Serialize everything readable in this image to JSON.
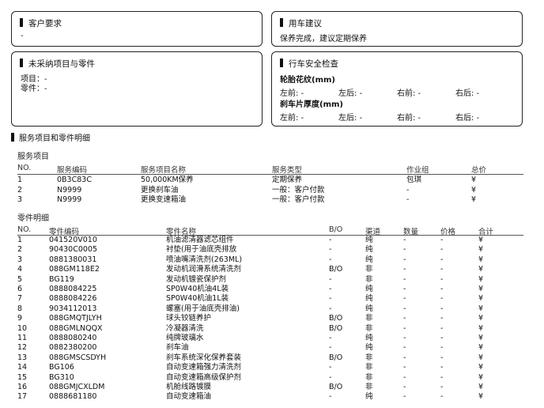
{
  "customer_request": {
    "title": "客户要求",
    "value": "-"
  },
  "suggestion": {
    "title": "用车建议",
    "value": "保养完成，建议定期保养"
  },
  "unpurchased": {
    "title": "未采纳项目与零件",
    "items_line": "项目：-",
    "parts_line": "零件：-"
  },
  "safety": {
    "title": "行车安全检查",
    "tread_title": "轮胎花纹(mm)",
    "brake_title": "刹车片厚度(mm)",
    "cells": [
      "左前:  -",
      "左后:  -",
      "右前:  -",
      "右后:  -"
    ]
  },
  "detail_section_title": "服务项目和零件明细",
  "services": {
    "subtitle": "服务项目",
    "headers": [
      "NO.",
      "服务编码",
      "服务项目名称",
      "服务类型",
      "作业组",
      "总价"
    ],
    "rows": [
      [
        "1",
        "0B3C83C",
        "50,000KM保养",
        "定期保养",
        "包琪",
        "¥"
      ],
      [
        "2",
        "N9999",
        "更换刹车油",
        "一般：客户付款",
        "-",
        "¥"
      ],
      [
        "3",
        "N9999",
        "更换变速箱油",
        "一般：客户付款",
        "-",
        "¥"
      ]
    ]
  },
  "parts": {
    "subtitle": "零件明细",
    "headers": [
      "NO.",
      "零件编码",
      "零件名称",
      "B/O",
      "渠道",
      "数量",
      "价格",
      "合计"
    ],
    "rows": [
      [
        "1",
        "041520V010",
        "机油滤清器滤芯组件",
        "-",
        "纯",
        "-",
        "-",
        "¥"
      ],
      [
        "2",
        "90430C0005",
        "衬垫(用于油底壳排放",
        "-",
        "纯",
        "-",
        "-",
        "¥"
      ],
      [
        "3",
        "0881380031",
        "喷油嘴清洗剂(263ML)",
        "-",
        "纯",
        "-",
        "-",
        "¥"
      ],
      [
        "4",
        "088GM118E2",
        "发动机润滑系统清洗剂",
        "B/O",
        "非",
        "-",
        "-",
        "¥"
      ],
      [
        "5",
        "BG119",
        "发动机镀瓷保护剂",
        "-",
        "非",
        "-",
        "-",
        "¥"
      ],
      [
        "6",
        "0888084225",
        "SP0W40机油4L装",
        "-",
        "纯",
        "-",
        "-",
        "¥"
      ],
      [
        "7",
        "0888084226",
        "SP0W40机油1L装",
        "-",
        "纯",
        "-",
        "-",
        "¥"
      ],
      [
        "8",
        "9034112013",
        "螺塞(用于油底壳排油)",
        "-",
        "纯",
        "-",
        "-",
        "¥"
      ],
      [
        "9",
        "088GMQTJLYH",
        "球头铰链养护",
        "B/O",
        "非",
        "-",
        "-",
        "¥"
      ],
      [
        "10",
        "088GMLNQQX",
        "冷凝器清洗",
        "B/O",
        "非",
        "-",
        "-",
        "¥"
      ],
      [
        "11",
        "0888080240",
        "纯牌玻璃水",
        "-",
        "纯",
        "-",
        "-",
        "¥"
      ],
      [
        "12",
        "0882380200",
        "刹车油",
        "-",
        "纯",
        "-",
        "-",
        "¥"
      ],
      [
        "13",
        "088GMSCSDYH",
        "刹车系统深化保养套装",
        "B/O",
        "非",
        "-",
        "-",
        "¥"
      ],
      [
        "14",
        "BG106",
        "自动变速箱强力清洗剂",
        "-",
        "非",
        "-",
        "-",
        "¥"
      ],
      [
        "15",
        "BG310",
        "自动变速箱高级保护剂",
        "-",
        "非",
        "-",
        "-",
        "¥"
      ],
      [
        "16",
        "088GMJCXLDM",
        "机舱线路镀膜",
        "B/O",
        "非",
        "-",
        "-",
        "¥"
      ],
      [
        "17",
        "0888681180",
        "自动变速箱油",
        "-",
        "纯",
        "-",
        "-",
        "¥"
      ]
    ]
  }
}
